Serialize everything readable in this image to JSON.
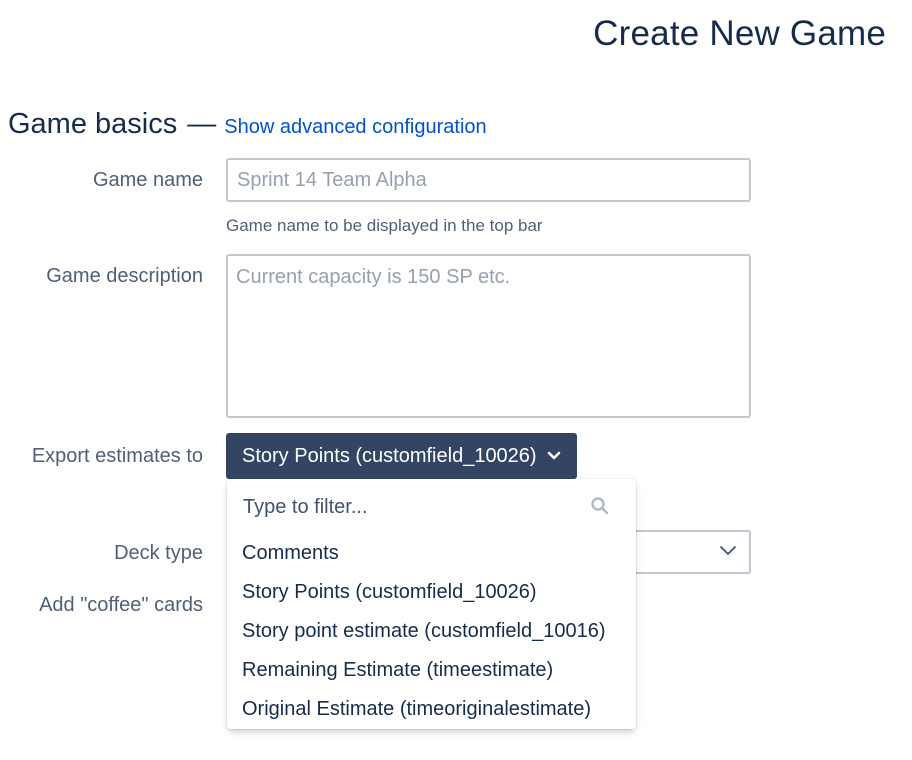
{
  "page_title": "Create New Game",
  "section": {
    "title": "Game basics",
    "dash": "—",
    "advanced_link": "Show advanced configuration"
  },
  "fields": {
    "game_name": {
      "label": "Game name",
      "placeholder": "Sprint 14 Team Alpha",
      "help": "Game name to be displayed in the top bar"
    },
    "game_description": {
      "label": "Game description",
      "placeholder": "Current capacity is 150 SP etc."
    },
    "export_estimates": {
      "label": "Export estimates to",
      "selected": "Story Points (customfield_10026)"
    },
    "deck_type": {
      "label": "Deck type"
    },
    "coffee_cards": {
      "label": "Add \"coffee\" cards"
    }
  },
  "dropdown": {
    "filter_placeholder": "Type to filter...",
    "options": [
      "Comments",
      "Story Points (customfield_10026)",
      "Story point estimate (customfield_10016)",
      "Remaining Estimate (timeestimate)",
      "Original Estimate (timeoriginalestimate)"
    ]
  },
  "icons": {
    "select_caret": "chevron-down-icon",
    "filter": "search-icon",
    "deck_caret": "chevron-down-icon"
  },
  "colors": {
    "primary_text": "#172b4d",
    "label_text": "#505f79",
    "link": "#0052cc",
    "selected_button_bg": "#344563",
    "input_border": "#c1c7d0"
  }
}
